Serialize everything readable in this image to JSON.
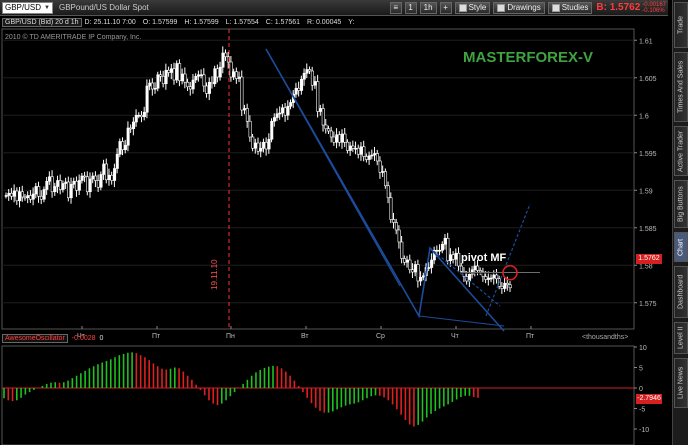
{
  "toolbar": {
    "symbol": "GBP/USD",
    "description": "GBPound/US Dollar Spot",
    "link_btn": "1",
    "period_btn": "1h",
    "style_btn": "Style",
    "drawings_btn": "Drawings",
    "studies_btn": "Studies",
    "price": "B: 1.5762",
    "price_change_1": "-0.00167",
    "price_change_2": "-0.106%"
  },
  "chart_info": {
    "symbol": "GBP/USD (Bid) 20 d 1h",
    "date": "D: 25.11.10 7:00",
    "open": "O: 1.57599",
    "high": "H: 1.57599",
    "low": "L: 1.57554",
    "close": "C: 1.57561",
    "range": "R: 0.00045",
    "y": "Y:"
  },
  "copyright": "2010 © TD AMERITRADE IP Company, Inc.",
  "watermark": "MASTERFOREX-V",
  "annotations": {
    "pivot": "pivot MF",
    "date_marker": "19.11.10"
  },
  "colors": {
    "up_candle": "#ffffff",
    "down_candle": "#000000",
    "trendline": "#1c4c9c",
    "watermark": "#3fa33f",
    "osc_up": "#20c020",
    "osc_down": "#e02020",
    "price_tag": "#d42020",
    "marker_line": "#ff3030"
  },
  "oscillator": {
    "name": "AwesomeOscillator",
    "value": "-0.0028",
    "value2": "0",
    "units": "<thousandths>",
    "tag": "-2.7946"
  },
  "price_tag": "1.5762",
  "sidetabs": [
    "Trade",
    "Times And Sales",
    "Active Trader",
    "Big Buttons",
    "Chart",
    "Dashboard",
    "Level II",
    "Live News"
  ],
  "chart_data": {
    "type": "candlestick",
    "symbol": "GBP/USD",
    "ylim": [
      1.5715,
      1.6115
    ],
    "y_ticks": [
      "1.61",
      "1.605",
      "1.6",
      "1.595",
      "1.59",
      "1.585",
      "1.58",
      "1.575"
    ],
    "x_ticks": [
      "Чт",
      "Пт",
      "Пн",
      "Вт",
      "Ср",
      "Чт",
      "Пт"
    ],
    "pivot_level": 1.579,
    "close": [
      1.5893,
      1.5896,
      1.5892,
      1.5899,
      1.5886,
      1.5898,
      1.5891,
      1.589,
      1.5893,
      1.5888,
      1.5895,
      1.5905,
      1.5892,
      1.5888,
      1.5901,
      1.5912,
      1.5918,
      1.5898,
      1.5905,
      1.5913,
      1.5901,
      1.5909,
      1.5911,
      1.589,
      1.5908,
      1.5912,
      1.59,
      1.5913,
      1.5919,
      1.5918,
      1.5898,
      1.5915,
      1.5919,
      1.5913,
      1.5904,
      1.5921,
      1.5935,
      1.5914,
      1.592,
      1.5913,
      1.5929,
      1.5948,
      1.5965,
      1.5954,
      1.596,
      1.5983,
      1.5982,
      1.5991,
      1.6,
      1.6,
      1.5998,
      1.6004,
      1.6039,
      1.6043,
      1.6035,
      1.6036,
      1.6054,
      1.6052,
      1.6042,
      1.606,
      1.6057,
      1.6062,
      1.6047,
      1.6069,
      1.6046,
      1.6055,
      1.6044,
      1.6038,
      1.6035,
      1.6047,
      1.6052,
      1.6054,
      1.6054,
      1.6039,
      1.6029,
      1.6044,
      1.6042,
      1.6062,
      1.6051,
      1.6064,
      1.6083,
      1.6078,
      1.6071,
      1.6051,
      1.6058,
      1.6049,
      1.6051,
      1.6007,
      1.6009,
      1.5992,
      1.5971,
      1.5956,
      1.5963,
      1.5952,
      1.5956,
      1.5964,
      1.5955,
      1.5968,
      1.5992,
      1.5997,
      1.6002,
      1.6003,
      1.601,
      1.6,
      1.6012,
      1.6017,
      1.6028,
      1.6036,
      1.6033,
      1.6048,
      1.6056,
      1.6061,
      1.6059,
      1.604,
      1.6045,
      1.6005,
      1.6009,
      1.5987,
      1.5982,
      1.5979,
      1.5971,
      1.5964,
      1.5974,
      1.5964,
      1.5975,
      1.5964,
      1.5953,
      1.5959,
      1.5956,
      1.5956,
      1.5948,
      1.5958,
      1.5945,
      1.5941,
      1.5946,
      1.5947,
      1.5949,
      1.5939,
      1.5924,
      1.5925,
      1.5906,
      1.589,
      1.5861,
      1.5857,
      1.5847,
      1.5831,
      1.5809,
      1.5804,
      1.5807,
      1.5794,
      1.5791,
      1.5801,
      1.5779,
      1.5784,
      1.5786,
      1.5797,
      1.5797,
      1.5807,
      1.582,
      1.582,
      1.582,
      1.5828,
      1.5836,
      1.5806,
      1.5814,
      1.5808,
      1.5816,
      1.5799,
      1.5792,
      1.5785,
      1.5779,
      1.5788,
      1.5794,
      1.5799,
      1.5793,
      1.5791,
      1.5785,
      1.5781,
      1.5783,
      1.5783,
      1.5787,
      1.5782,
      1.5772,
      1.5769,
      1.5776,
      1.5774,
      1.577
    ],
    "awesome_oscillator": [
      -2.5,
      -3.0,
      -3.2,
      -3.0,
      -2.4,
      -1.6,
      -1.0,
      -0.5,
      0.0,
      0.5,
      1.0,
      1.3,
      1.4,
      1.3,
      1.4,
      1.8,
      2.4,
      3.0,
      3.6,
      4.2,
      4.8,
      5.3,
      5.8,
      6.2,
      6.6,
      7.0,
      7.5,
      8.0,
      8.3,
      8.6,
      8.7,
      8.5,
      8.0,
      7.5,
      6.8,
      6.0,
      5.3,
      4.7,
      4.5,
      4.7,
      5.0,
      4.8,
      4.0,
      3.0,
      2.0,
      0.8,
      -0.5,
      -1.8,
      -3.0,
      -3.8,
      -4.2,
      -3.8,
      -3.0,
      -2.0,
      -1.0,
      0.0,
      1.0,
      2.0,
      3.0,
      3.8,
      4.4,
      4.9,
      5.2,
      5.4,
      5.3,
      4.8,
      4.0,
      3.0,
      1.8,
      0.5,
      -1.0,
      -2.4,
      -3.7,
      -4.8,
      -5.6,
      -6.0,
      -6.0,
      -5.7,
      -5.2,
      -4.7,
      -4.3,
      -4.0,
      -3.8,
      -3.5,
      -3.0,
      -2.5,
      -2.0,
      -1.8,
      -1.9,
      -2.3,
      -3.0,
      -4.0,
      -5.2,
      -6.5,
      -7.8,
      -8.9,
      -9.4,
      -9.0,
      -8.2,
      -7.2,
      -6.3,
      -5.6,
      -5.0,
      -4.5,
      -4.0,
      -3.4,
      -2.8,
      -2.2,
      -1.9,
      -1.9,
      -2.2,
      -2.4
    ]
  }
}
